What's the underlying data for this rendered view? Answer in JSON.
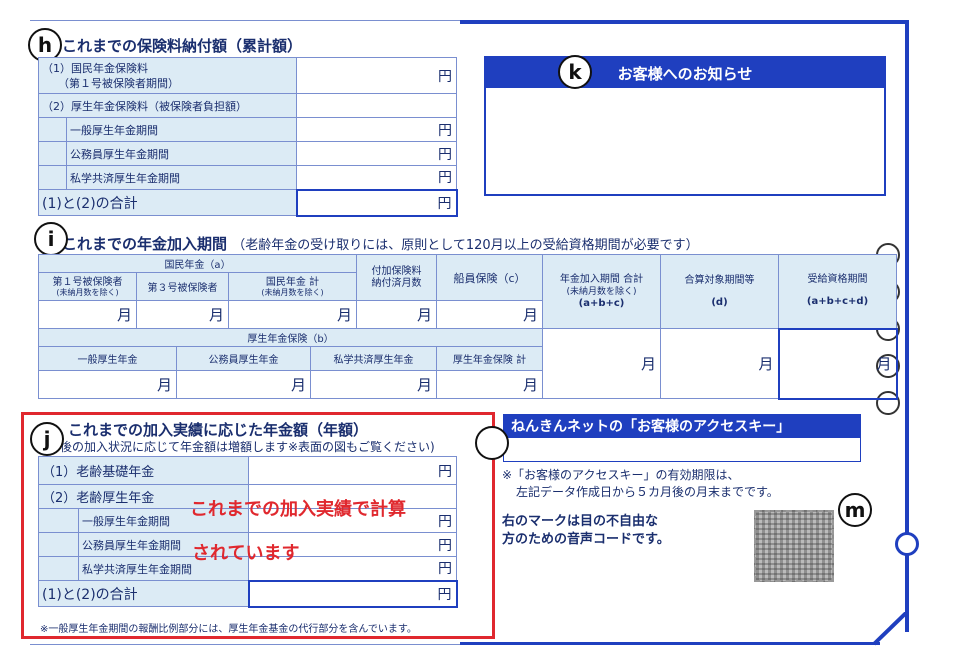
{
  "markers": {
    "h": "h",
    "i": "i",
    "j": "j",
    "k": "k",
    "m": "m"
  },
  "sec_h": {
    "title": "これまでの保険料納付額（累計額）",
    "row1_label": "（1）国民年金保険料",
    "row1_sub": "（第１号被保険者期間）",
    "row2_label": "（2）厚生年金保険料（被保険者負担額）",
    "sub_rows": [
      "一般厚生年金期間",
      "公務員厚生年金期間",
      "私学共済厚生年金期間"
    ],
    "total_label": "(1)と(2)の合計",
    "unit": "円"
  },
  "notice": {
    "title": "お客様へのお知らせ"
  },
  "sec_i": {
    "title": "これまでの年金加入期間",
    "note": "（老齢年金の受け取りには、原則として120月以上の受給資格期間が必要です）",
    "national_group": "国民年金（a）",
    "col_1go": "第１号被保険者",
    "col_1go_sub": "(未納月数を除く)",
    "col_3go": "第３号被保険者",
    "col_kokumin_total": "国民年金 計",
    "col_kokumin_total_sub": "(未納月数を除く)",
    "col_fuka": "付加保険料\n納付済月数",
    "col_senin": "船員保険（c）",
    "col_total": "年金加入期間 合計",
    "col_total_sub": "(未納月数を除く)",
    "col_total_formula": "(a+b+c)",
    "col_taisho": "合算対象期間等",
    "col_taisho_formula": "(d)",
    "col_jukyu": "受給資格期間",
    "col_jukyu_formula": "(a+b+c+d)",
    "kosei_group": "厚生年金保険（b）",
    "col_ippan": "一般厚生年金",
    "col_komuin": "公務員厚生年金",
    "col_shigaku": "私学共済厚生年金",
    "col_kosei_total": "厚生年金保険 計",
    "unit": "月"
  },
  "sec_j": {
    "title": "これまでの加入実績に応じた年金額（年額）",
    "note": "後の加入状況に応じて年金額は増額します※表面の図もご覧ください)",
    "row1_label": "（1）老齢基礎年金",
    "row2_label": "（2）老齢厚生年金",
    "sub_rows": [
      "一般厚生年金期間",
      "公務員厚生年金期間",
      "私学共済厚生年金期間"
    ],
    "total_label": "(1)と(2)の合計",
    "unit": "円",
    "footnote": "※一般厚生年金期間の報酬比例部分には、厚生年金基金の代行部分を含んでいます。",
    "overlay_line1": "これまでの加入実績で計算",
    "overlay_line2": "されています"
  },
  "access_key": {
    "title": "ねんきんネットの「お客様のアクセスキー」",
    "note1": "※「お客様のアクセスキー」の有効期限は、",
    "note2": "左記データ作成日から５カ月後の月末までです。"
  },
  "voice_code": {
    "line1": "右のマークは目の不自由な",
    "line2": "方のための音声コードです。"
  }
}
